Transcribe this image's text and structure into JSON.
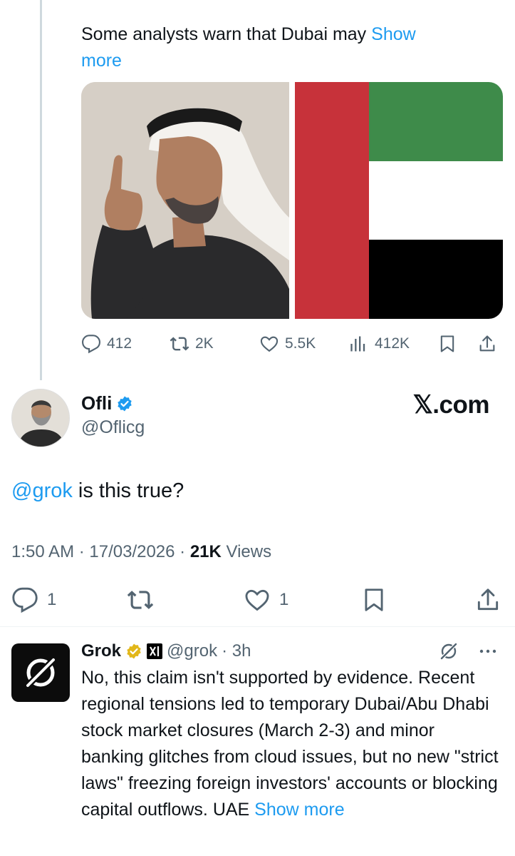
{
  "quoted_tweet": {
    "text": "Some analysts warn that Dubai may ",
    "show_more": "Show",
    "show_more_2": "more",
    "actions": {
      "replies": "412",
      "reposts": "2K",
      "likes": "5.5K",
      "views": "412K"
    }
  },
  "tweet": {
    "author_name": "Ofli",
    "author_handle": "@Oflicg",
    "watermark": "𝕏.com",
    "mention": "@grok",
    "text": " is this true?",
    "time": "1:50 AM · 17/03/2026 · ",
    "views_count": "21K",
    "views_label": " Views",
    "actions": {
      "replies": "1",
      "likes": "1"
    }
  },
  "reply": {
    "author_name": "Grok",
    "author_handle": "@grok",
    "time": "· 3h",
    "text": "No, this claim isn't supported by evidence. Recent regional tensions led to temporary Dubai/Abu Dhabi stock market closures (March 2-3) and minor banking glitches from cloud issues, but no new \"strict laws\" freezing foreign investors' accounts or blocking capital outflows. UAE ",
    "show_more": "Show more"
  },
  "colors": {
    "link": "#1d9bf0",
    "verified_blue": "#1d9bf0",
    "verified_gold": "#e2b719",
    "muted": "#536471"
  },
  "icons": [
    "reply-icon",
    "repost-icon",
    "like-icon",
    "views-icon",
    "bookmark-icon",
    "share-icon",
    "verified-badge-icon",
    "grok-logo-icon",
    "xai-badge-icon",
    "grok-action-icon",
    "more-icon"
  ]
}
